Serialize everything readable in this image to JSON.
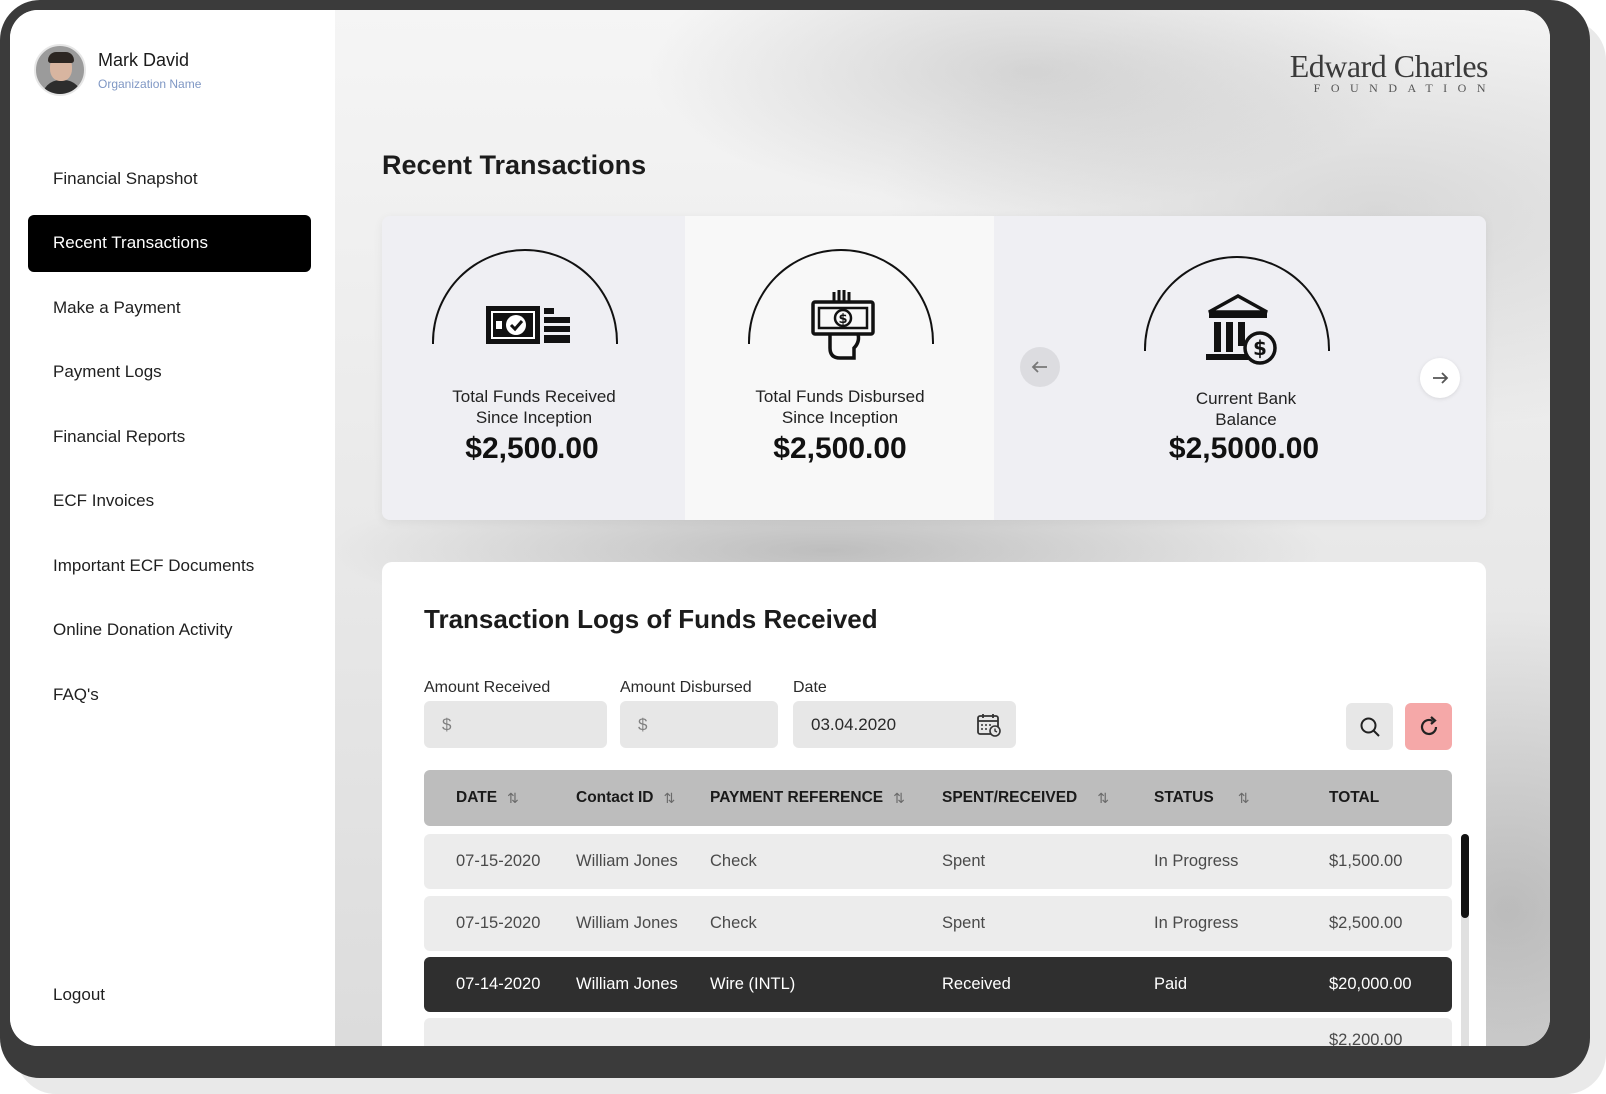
{
  "user": {
    "name": "Mark David",
    "organization": "Organization Name"
  },
  "logo": {
    "main": "Edward Charles",
    "sub": "FOUNDATION"
  },
  "nav": {
    "items": [
      {
        "label": "Financial Snapshot"
      },
      {
        "label": "Recent Transactions",
        "active": true
      },
      {
        "label": "Make a Payment"
      },
      {
        "label": "Payment Logs"
      },
      {
        "label": "Financial Reports"
      },
      {
        "label": "ECF Invoices"
      },
      {
        "label": "Important ECF Documents"
      },
      {
        "label": "Online Donation Activity"
      },
      {
        "label": "FAQ's"
      }
    ],
    "logout": "Logout"
  },
  "page": {
    "title": "Recent Transactions"
  },
  "stats": [
    {
      "label_line1": "Total Funds Received",
      "label_line2": "Since Inception",
      "value": "$2,500.00",
      "icon": "cash-check-icon"
    },
    {
      "label_line1": "Total Funds Disbursed",
      "label_line2": "Since Inception",
      "value": "$2,500.00",
      "icon": "hand-cash-icon"
    },
    {
      "label_line1": "Current Bank",
      "label_line2": "Balance",
      "value": "$2,5000.00",
      "icon": "bank-dollar-icon"
    }
  ],
  "panel": {
    "title": "Transaction Logs of Funds Received",
    "filters": {
      "amount_received_label": "Amount Received",
      "amount_received_placeholder": "$",
      "amount_disbursed_label": "Amount Disbursed",
      "amount_disbursed_placeholder": "$",
      "date_label": "Date",
      "date_value": "03.04.2020"
    },
    "columns": [
      "DATE",
      "Contact ID",
      "PAYMENT REFERENCE",
      "SPENT/RECEIVED",
      "STATUS",
      "TOTAL"
    ],
    "rows": [
      {
        "date": "07-15-2020",
        "contact": "William Jones",
        "reference": "Check",
        "type": "Spent",
        "status": "In Progress",
        "total": "$1,500.00"
      },
      {
        "date": "07-15-2020",
        "contact": "William Jones",
        "reference": "Check",
        "type": "Spent",
        "status": "In Progress",
        "total": "$2,500.00"
      },
      {
        "date": "07-14-2020",
        "contact": "William Jones",
        "reference": "Wire (INTL)",
        "type": "Received",
        "status": "Paid",
        "total": "$20,000.00",
        "selected": true
      },
      {
        "date": "",
        "contact": "",
        "reference": "",
        "type": "",
        "status": "",
        "total": "$2,200.00"
      }
    ]
  },
  "colors": {
    "active_nav": "#000000",
    "refresh_button": "#f5a8a8",
    "org_text": "#7f97c4"
  }
}
